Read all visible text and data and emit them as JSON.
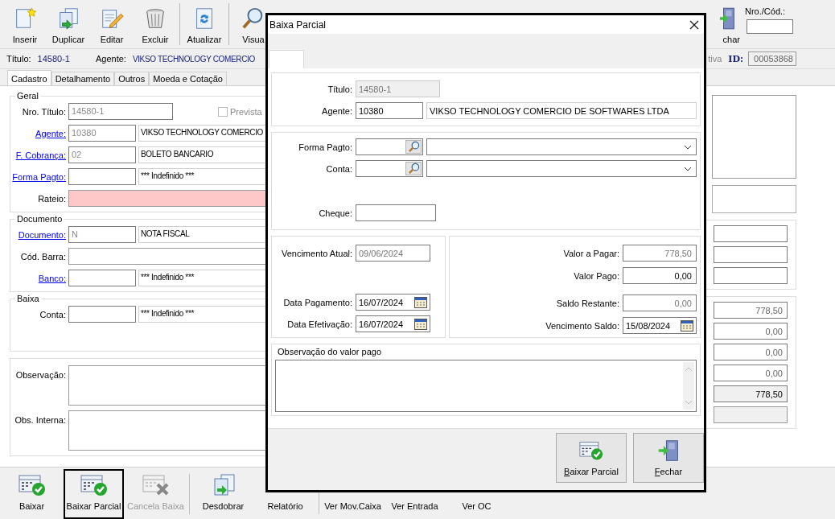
{
  "app": {
    "toolbar": {
      "items": [
        {
          "kind": "button",
          "label": "Inserir"
        },
        {
          "kind": "button",
          "label": "Duplicar"
        },
        {
          "kind": "button",
          "label": "Editar"
        },
        {
          "kind": "button",
          "label": "Excluir"
        },
        {
          "kind": "separator"
        },
        {
          "kind": "button",
          "label": "Atualizar"
        },
        {
          "kind": "separator"
        },
        {
          "kind": "button",
          "label": "Visua"
        }
      ],
      "close": {
        "label": "char"
      },
      "code_field": {
        "label": "Nro./Cód.:"
      }
    },
    "info": {
      "title_label": "Título:",
      "title": "14580-1",
      "agent_label": "Agente:",
      "agent": "VIKSO TECHNOLOGY COMERCIO",
      "status": "tiva",
      "id_label": "ID:",
      "id": "00053868"
    },
    "tabs": [
      {
        "label": "Cadastro",
        "selected": true
      },
      {
        "label": "Detalhamento",
        "selected": false
      },
      {
        "label": "Outros",
        "selected": false
      },
      {
        "label": "Moeda e Cotação",
        "selected": false
      }
    ],
    "form": {
      "groups": [
        {
          "title": "Geral",
          "rows": [
            {
              "kind": "title",
              "label": "Nro. Título:",
              "link": false,
              "code": "14580-1",
              "check": {
                "label": "Prevista",
                "checked": false,
                "disabled": true
              }
            },
            {
              "kind": "lookup",
              "label": "Agente:",
              "link": true,
              "code": "10380",
              "desc": "VIKSO TECHNOLOGY COMERCIO"
            },
            {
              "kind": "lookup",
              "label": "F. Cobrança:",
              "link": true,
              "code": "02",
              "desc": "BOLETO BANCARIO"
            },
            {
              "kind": "lookup",
              "label": "Forma Pagto:",
              "link": true,
              "desc": "*** Indefinido ***"
            },
            {
              "kind": "rateio",
              "label": "Rateio:",
              "link": false
            }
          ]
        },
        {
          "title": "Documento",
          "rows": [
            {
              "kind": "lookup",
              "label": "Documento:",
              "link": true,
              "code": "N",
              "desc": "NOTA FISCAL"
            },
            {
              "kind": "wide",
              "label": "Cód. Barra:",
              "link": false
            },
            {
              "kind": "lookup",
              "label": "Banco:",
              "link": true,
              "desc": "*** Indefinido ***"
            }
          ]
        },
        {
          "title": "Baixa",
          "rows": [
            {
              "kind": "lookup",
              "label": "Conta:",
              "link": false,
              "desc": "*** Indefinido ***"
            }
          ]
        },
        {
          "rows": [
            {
              "kind": "memo",
              "label": "Observação:",
              "link": false
            },
            {
              "kind": "memo",
              "label": "Obs. Interna:",
              "link": false
            }
          ]
        }
      ]
    },
    "totals": [
      {
        "kind": "plain",
        "value": "778,50"
      },
      {
        "kind": "plain",
        "value": "0,00"
      },
      {
        "kind": "plain",
        "value": "0,00"
      },
      {
        "kind": "plain",
        "value": "0,00"
      },
      {
        "kind": "total",
        "value": "778,50"
      }
    ],
    "bottom_toolbar": [
      {
        "kind": "button",
        "label": "Baixar",
        "selected": false,
        "disabled": false
      },
      {
        "kind": "button",
        "label": "Baixar Parcial",
        "selected": true,
        "disabled": false
      },
      {
        "kind": "button",
        "label": "Cancela Baixa",
        "selected": false,
        "disabled": true
      },
      {
        "kind": "separator"
      },
      {
        "kind": "button",
        "label": "Desdobrar",
        "selected": false,
        "disabled": false
      },
      {
        "kind": "button",
        "label": "Relatório",
        "selected": false,
        "disabled": false
      },
      {
        "kind": "separator"
      },
      {
        "kind": "button",
        "label": "Ver Mov.Caixa",
        "selected": false,
        "disabled": false
      },
      {
        "kind": "button",
        "label": "Ver Entrada",
        "selected": false,
        "disabled": false
      },
      {
        "kind": "button",
        "label": "Ver OC",
        "selected": false,
        "disabled": false
      }
    ]
  },
  "dialog": {
    "title": "Baixa Parcial",
    "identity": [
      {
        "kind": "single",
        "label": "Título:",
        "value": "14580-1",
        "disabled": true
      },
      {
        "kind": "pair",
        "label": "Agente:",
        "value": "10380",
        "name": "VIKSO TECHNOLOGY COMERCIO DE SOFTWARES LTDA",
        "disabled": false
      }
    ],
    "lookups": [
      {
        "label": "Forma Pagto:"
      },
      {
        "label": "Conta:"
      }
    ],
    "cheque": {
      "label": "Cheque:"
    },
    "dates": [
      {
        "label": "Vencimento Atual:",
        "value": "09/06/2024",
        "disabled": true,
        "calendar": false
      },
      {
        "label": "Data Pagamento:",
        "value": "16/07/2024",
        "disabled": false,
        "calendar": true
      },
      {
        "label": "Data Efetivação:",
        "value": "16/07/2024",
        "disabled": false,
        "calendar": true
      }
    ],
    "amounts": [
      {
        "kind": "amount",
        "label": "Valor a Pagar:",
        "value": "778,50",
        "disabled": true
      },
      {
        "kind": "amount",
        "label": "Valor Pago:",
        "value": "0,00",
        "disabled": false
      },
      {
        "kind": "separator"
      },
      {
        "kind": "amount",
        "label": "Saldo Restante:",
        "value": "0,00",
        "disabled": true
      },
      {
        "kind": "date",
        "label": "Vencimento Saldo:",
        "value": "15/08/2024",
        "disabled": false
      }
    ],
    "notes": {
      "title": "Observação do valor pago"
    },
    "buttons": [
      {
        "kind": "confirm",
        "label": "Baixar Parcial"
      },
      {
        "kind": "close",
        "label": "Fechar"
      }
    ]
  }
}
